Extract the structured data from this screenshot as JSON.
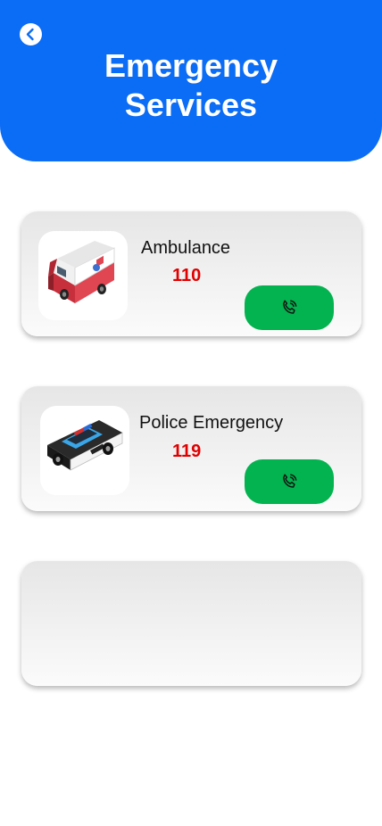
{
  "header": {
    "title_line1": "Emergency",
    "title_line2": "Services",
    "accent_color": "#0b6cf5",
    "back_icon": "chevron-left-icon"
  },
  "services": [
    {
      "name": "Ambulance",
      "number": "110",
      "image": "ambulance-illustration",
      "call_icon": "phone-call-icon"
    },
    {
      "name": "Police Emergency",
      "number": "119",
      "image": "police-car-illustration",
      "call_icon": "phone-call-icon"
    }
  ],
  "colors": {
    "call_button": "#03b34f",
    "number_text": "#e00000"
  }
}
